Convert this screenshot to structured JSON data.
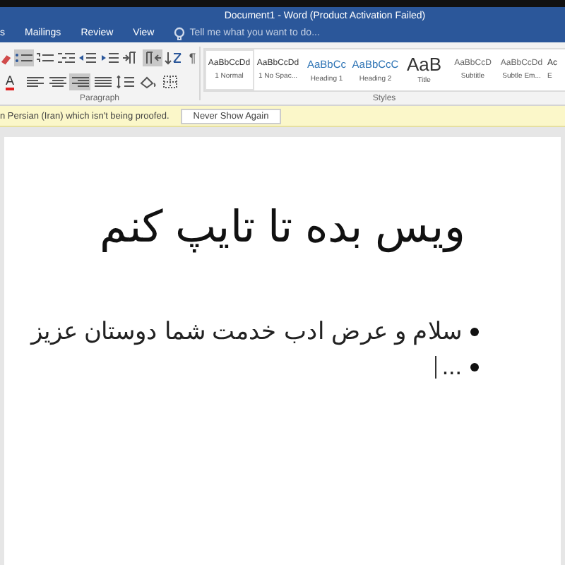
{
  "window": {
    "title": "Document1 - Word (Product Activation Failed)"
  },
  "tabs": [
    {
      "label": "s",
      "selected": false
    },
    {
      "label": "Mailings",
      "selected": false
    },
    {
      "label": "Review",
      "selected": false
    },
    {
      "label": "View",
      "selected": false
    }
  ],
  "tell_me": {
    "placeholder": "Tell me what you want to do..."
  },
  "ribbon": {
    "paragraph": {
      "label": "Paragraph",
      "font_color_glyph": "A",
      "pilcrow": "¶",
      "row_1": [
        {
          "kind": "bullets",
          "on": true
        },
        {
          "kind": "numbering",
          "on": false
        },
        {
          "kind": "multilevel",
          "on": false
        },
        {
          "kind": "outdent",
          "on": false
        },
        {
          "kind": "indent",
          "on": false
        },
        {
          "kind": "ltr",
          "on": false
        },
        {
          "kind": "rtl",
          "on": true
        },
        {
          "kind": "sort",
          "on": false
        }
      ],
      "row_2": [
        {
          "kind": "left",
          "on": false
        },
        {
          "kind": "center",
          "on": false
        },
        {
          "kind": "right",
          "on": true
        },
        {
          "kind": "justify",
          "on": false
        },
        {
          "kind": "spacing",
          "on": false
        },
        {
          "kind": "shading",
          "on": false
        },
        {
          "kind": "borders",
          "on": false
        }
      ]
    },
    "styles": {
      "label": "Styles",
      "items": [
        {
          "preview": "AaBbCcDd",
          "name": "1 Normal",
          "kind": "normal",
          "selected": true
        },
        {
          "preview": "AaBbCcDd",
          "name": "1 No Spac...",
          "kind": "normal",
          "selected": false
        },
        {
          "preview": "AaBbCc",
          "name": "Heading 1",
          "kind": "heading",
          "selected": false
        },
        {
          "preview": "AaBbCcC",
          "name": "Heading 2",
          "kind": "heading",
          "selected": false
        },
        {
          "preview": "AaB",
          "name": "Title",
          "kind": "title",
          "selected": false
        },
        {
          "preview": "AaBbCcD",
          "name": "Subtitle",
          "kind": "subtle",
          "selected": false
        },
        {
          "preview": "AaBbCcDd",
          "name": "Subtle Em...",
          "kind": "subtle",
          "selected": false
        },
        {
          "preview": "Ac",
          "name": "E",
          "kind": "normal",
          "selected": false
        }
      ]
    }
  },
  "message_bar": {
    "text": "n Persian (Iran) which isn't being proofed.",
    "button": "Never Show Again"
  },
  "document": {
    "heading": "ویس بده تا تایپ کنم",
    "bullets": [
      {
        "text": "سلام و عرض ادب خدمت شما دوستان عزیز",
        "has_cursor": false
      },
      {
        "text": "...",
        "has_cursor": true
      }
    ]
  }
}
